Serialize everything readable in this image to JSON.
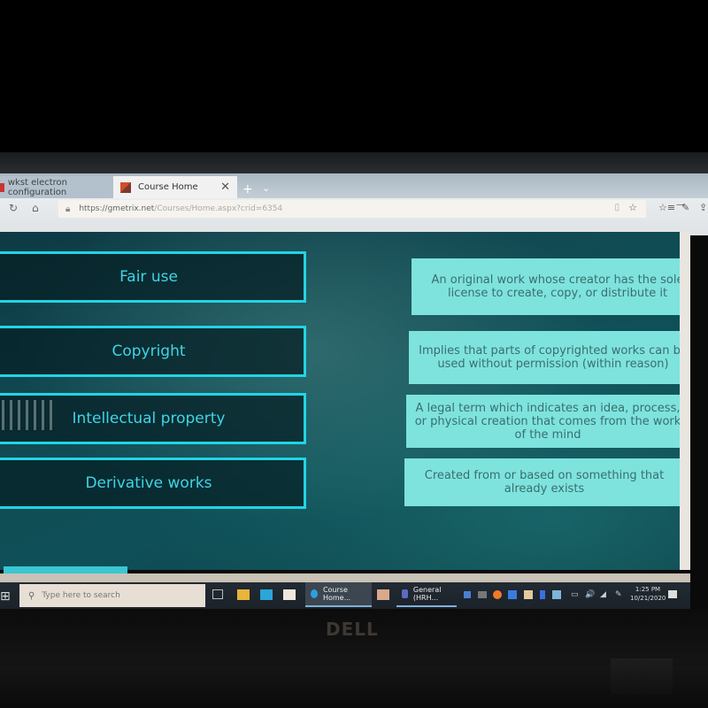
{
  "browser": {
    "tabs": [
      {
        "label": "wkst electron configuration",
        "active": false
      },
      {
        "label": "Course Home",
        "active": true
      }
    ],
    "new_tab_label": "+",
    "tab_menu_label": "⌄",
    "close_tab_label": "✕",
    "url": {
      "host": "https://gmetrix.net",
      "path": "/Courses/Home.aspx?crid=6354"
    },
    "icons": {
      "refresh": "↻",
      "home": "⌂",
      "lock": "🔒",
      "reading_view": "▯",
      "favorite": "☆",
      "favorites_list": "☆≡",
      "notes": "✎",
      "share": "⇪",
      "minimize": "—"
    }
  },
  "activity": {
    "terms": [
      {
        "label": "Fair use"
      },
      {
        "label": "Copyright"
      },
      {
        "label": "Intellectual property"
      },
      {
        "label": "Derivative works"
      }
    ],
    "definitions": [
      {
        "text": "An original work whose creator has the sole license to create, copy, or distribute it"
      },
      {
        "text": "Implies that parts of copyrighted works can be used without permission (within reason)"
      },
      {
        "text": "A legal term which indicates an idea, process, or physical creation that comes from the work of the mind"
      },
      {
        "text": "Created from or based on something that already exists"
      }
    ],
    "colors": {
      "term_border": "#22d4e4",
      "term_text": "#3fd5e5",
      "definition_bg": "#7ee3dd",
      "definition_text": "#3a6e70"
    }
  },
  "taskbar": {
    "start_icon": "⊞",
    "search_icon": "⚲",
    "search_placeholder": "Type here to search",
    "apps": [
      {
        "label": "Course Home..."
      },
      {
        "label": "General (HRH..."
      }
    ],
    "tray_icons": [
      "◔",
      "▭",
      "🔊",
      "◢",
      "✎"
    ],
    "time": "1:25 PM",
    "date": "10/21/2020"
  },
  "hardware": {
    "brand": "DELL"
  }
}
